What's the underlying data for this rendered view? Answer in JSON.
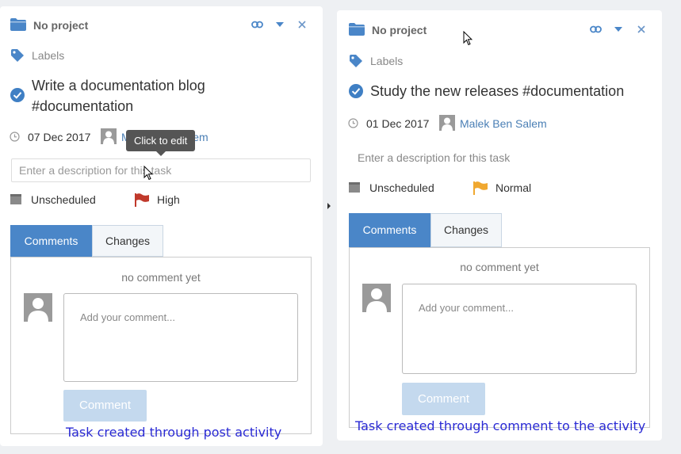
{
  "left_task": {
    "project": "No project",
    "labels": "Labels",
    "title_line1": "Write a documentation blog",
    "title_line2": "#documentation",
    "date": "07 Dec 2017",
    "assignee": "Malek Ben Salem",
    "tooltip": "Click to edit",
    "description_placeholder": "Enter a description for this task",
    "schedule": "Unscheduled",
    "priority": "High",
    "priority_color": "#c0392b",
    "tabs": [
      "Comments",
      "Changes"
    ],
    "no_comment": "no comment yet",
    "comment_placeholder": "Add your comment...",
    "comment_button": "Comment",
    "caption": "Task created through post activity"
  },
  "right_task": {
    "project": "No project",
    "labels": "Labels",
    "title": "Study the new releases #documentation",
    "date": "01 Dec 2017",
    "assignee": "Malek Ben Salem",
    "description_placeholder": "Enter a description for this task",
    "schedule": "Unscheduled",
    "priority": "Normal",
    "priority_color": "#f0a830",
    "tabs": [
      "Comments",
      "Changes"
    ],
    "no_comment": "no comment yet",
    "comment_placeholder": "Add your comment...",
    "comment_button": "Comment",
    "caption": "Task created through comment to the activity"
  },
  "colors": {
    "accent": "#4a86c8",
    "check": "#3f7fc4",
    "link": "#4a7fb5",
    "caption": "#2a2ad4"
  }
}
